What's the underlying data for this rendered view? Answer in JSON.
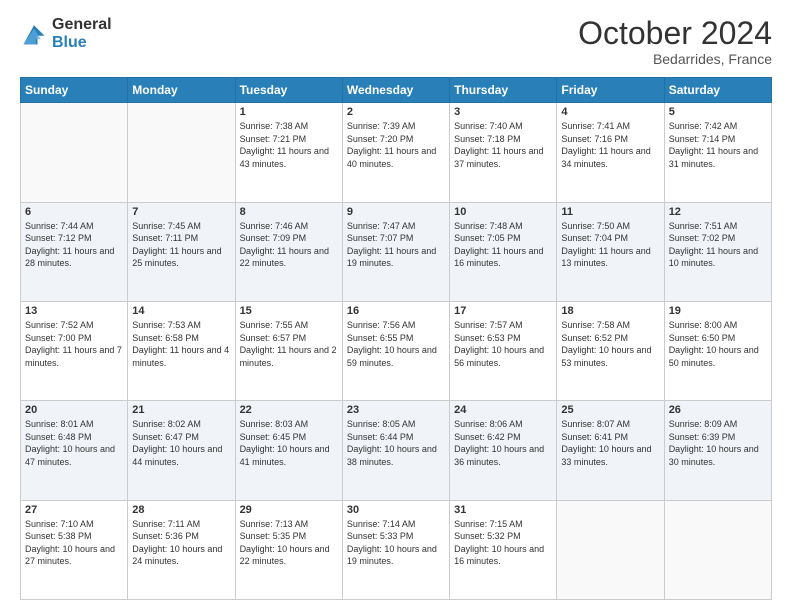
{
  "header": {
    "logo_line1": "General",
    "logo_line2": "Blue",
    "month_title": "October 2024",
    "location": "Bedarrides, France"
  },
  "weekdays": [
    "Sunday",
    "Monday",
    "Tuesday",
    "Wednesday",
    "Thursday",
    "Friday",
    "Saturday"
  ],
  "weeks": [
    [
      {
        "day": "",
        "sunrise": "",
        "sunset": "",
        "daylight": ""
      },
      {
        "day": "",
        "sunrise": "",
        "sunset": "",
        "daylight": ""
      },
      {
        "day": "1",
        "sunrise": "Sunrise: 7:38 AM",
        "sunset": "Sunset: 7:21 PM",
        "daylight": "Daylight: 11 hours and 43 minutes."
      },
      {
        "day": "2",
        "sunrise": "Sunrise: 7:39 AM",
        "sunset": "Sunset: 7:20 PM",
        "daylight": "Daylight: 11 hours and 40 minutes."
      },
      {
        "day": "3",
        "sunrise": "Sunrise: 7:40 AM",
        "sunset": "Sunset: 7:18 PM",
        "daylight": "Daylight: 11 hours and 37 minutes."
      },
      {
        "day": "4",
        "sunrise": "Sunrise: 7:41 AM",
        "sunset": "Sunset: 7:16 PM",
        "daylight": "Daylight: 11 hours and 34 minutes."
      },
      {
        "day": "5",
        "sunrise": "Sunrise: 7:42 AM",
        "sunset": "Sunset: 7:14 PM",
        "daylight": "Daylight: 11 hours and 31 minutes."
      }
    ],
    [
      {
        "day": "6",
        "sunrise": "Sunrise: 7:44 AM",
        "sunset": "Sunset: 7:12 PM",
        "daylight": "Daylight: 11 hours and 28 minutes."
      },
      {
        "day": "7",
        "sunrise": "Sunrise: 7:45 AM",
        "sunset": "Sunset: 7:11 PM",
        "daylight": "Daylight: 11 hours and 25 minutes."
      },
      {
        "day": "8",
        "sunrise": "Sunrise: 7:46 AM",
        "sunset": "Sunset: 7:09 PM",
        "daylight": "Daylight: 11 hours and 22 minutes."
      },
      {
        "day": "9",
        "sunrise": "Sunrise: 7:47 AM",
        "sunset": "Sunset: 7:07 PM",
        "daylight": "Daylight: 11 hours and 19 minutes."
      },
      {
        "day": "10",
        "sunrise": "Sunrise: 7:48 AM",
        "sunset": "Sunset: 7:05 PM",
        "daylight": "Daylight: 11 hours and 16 minutes."
      },
      {
        "day": "11",
        "sunrise": "Sunrise: 7:50 AM",
        "sunset": "Sunset: 7:04 PM",
        "daylight": "Daylight: 11 hours and 13 minutes."
      },
      {
        "day": "12",
        "sunrise": "Sunrise: 7:51 AM",
        "sunset": "Sunset: 7:02 PM",
        "daylight": "Daylight: 11 hours and 10 minutes."
      }
    ],
    [
      {
        "day": "13",
        "sunrise": "Sunrise: 7:52 AM",
        "sunset": "Sunset: 7:00 PM",
        "daylight": "Daylight: 11 hours and 7 minutes."
      },
      {
        "day": "14",
        "sunrise": "Sunrise: 7:53 AM",
        "sunset": "Sunset: 6:58 PM",
        "daylight": "Daylight: 11 hours and 4 minutes."
      },
      {
        "day": "15",
        "sunrise": "Sunrise: 7:55 AM",
        "sunset": "Sunset: 6:57 PM",
        "daylight": "Daylight: 11 hours and 2 minutes."
      },
      {
        "day": "16",
        "sunrise": "Sunrise: 7:56 AM",
        "sunset": "Sunset: 6:55 PM",
        "daylight": "Daylight: 10 hours and 59 minutes."
      },
      {
        "day": "17",
        "sunrise": "Sunrise: 7:57 AM",
        "sunset": "Sunset: 6:53 PM",
        "daylight": "Daylight: 10 hours and 56 minutes."
      },
      {
        "day": "18",
        "sunrise": "Sunrise: 7:58 AM",
        "sunset": "Sunset: 6:52 PM",
        "daylight": "Daylight: 10 hours and 53 minutes."
      },
      {
        "day": "19",
        "sunrise": "Sunrise: 8:00 AM",
        "sunset": "Sunset: 6:50 PM",
        "daylight": "Daylight: 10 hours and 50 minutes."
      }
    ],
    [
      {
        "day": "20",
        "sunrise": "Sunrise: 8:01 AM",
        "sunset": "Sunset: 6:48 PM",
        "daylight": "Daylight: 10 hours and 47 minutes."
      },
      {
        "day": "21",
        "sunrise": "Sunrise: 8:02 AM",
        "sunset": "Sunset: 6:47 PM",
        "daylight": "Daylight: 10 hours and 44 minutes."
      },
      {
        "day": "22",
        "sunrise": "Sunrise: 8:03 AM",
        "sunset": "Sunset: 6:45 PM",
        "daylight": "Daylight: 10 hours and 41 minutes."
      },
      {
        "day": "23",
        "sunrise": "Sunrise: 8:05 AM",
        "sunset": "Sunset: 6:44 PM",
        "daylight": "Daylight: 10 hours and 38 minutes."
      },
      {
        "day": "24",
        "sunrise": "Sunrise: 8:06 AM",
        "sunset": "Sunset: 6:42 PM",
        "daylight": "Daylight: 10 hours and 36 minutes."
      },
      {
        "day": "25",
        "sunrise": "Sunrise: 8:07 AM",
        "sunset": "Sunset: 6:41 PM",
        "daylight": "Daylight: 10 hours and 33 minutes."
      },
      {
        "day": "26",
        "sunrise": "Sunrise: 8:09 AM",
        "sunset": "Sunset: 6:39 PM",
        "daylight": "Daylight: 10 hours and 30 minutes."
      }
    ],
    [
      {
        "day": "27",
        "sunrise": "Sunrise: 7:10 AM",
        "sunset": "Sunset: 5:38 PM",
        "daylight": "Daylight: 10 hours and 27 minutes."
      },
      {
        "day": "28",
        "sunrise": "Sunrise: 7:11 AM",
        "sunset": "Sunset: 5:36 PM",
        "daylight": "Daylight: 10 hours and 24 minutes."
      },
      {
        "day": "29",
        "sunrise": "Sunrise: 7:13 AM",
        "sunset": "Sunset: 5:35 PM",
        "daylight": "Daylight: 10 hours and 22 minutes."
      },
      {
        "day": "30",
        "sunrise": "Sunrise: 7:14 AM",
        "sunset": "Sunset: 5:33 PM",
        "daylight": "Daylight: 10 hours and 19 minutes."
      },
      {
        "day": "31",
        "sunrise": "Sunrise: 7:15 AM",
        "sunset": "Sunset: 5:32 PM",
        "daylight": "Daylight: 10 hours and 16 minutes."
      },
      {
        "day": "",
        "sunrise": "",
        "sunset": "",
        "daylight": ""
      },
      {
        "day": "",
        "sunrise": "",
        "sunset": "",
        "daylight": ""
      }
    ]
  ]
}
